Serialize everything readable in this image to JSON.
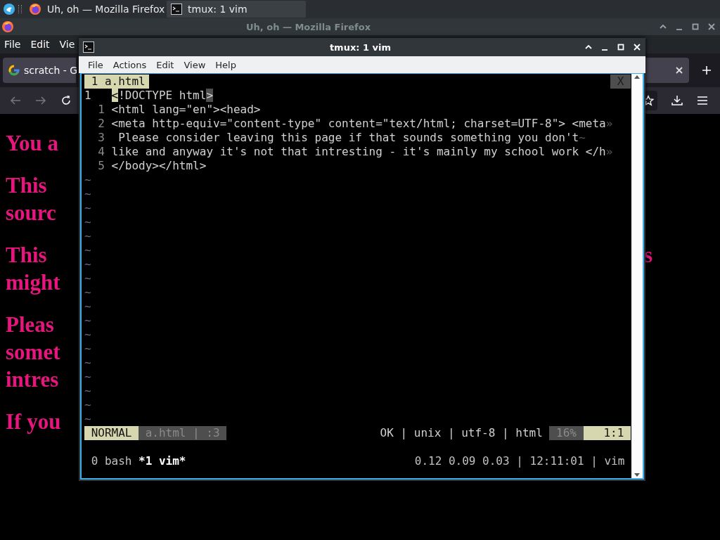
{
  "taskbar": {
    "tasks": [
      {
        "label": "Uh, oh — Mozilla Firefox",
        "kind": "browser",
        "selected": false
      },
      {
        "label": "tmux: 1 vim",
        "kind": "terminal",
        "selected": true
      }
    ]
  },
  "firefox": {
    "title": "Uh, oh — Mozilla Firefox",
    "menu": [
      "File",
      "Edit",
      "Vie"
    ],
    "tab": {
      "title": "scratch - G",
      "selected": true
    },
    "content": [
      {
        "lines": [
          {
            "text": "You a"
          }
        ]
      },
      {
        "lines": [
          {
            "text": "This"
          },
          {
            "text": "sourc"
          }
        ]
      },
      {
        "lines": [
          {
            "text": "This",
            "tail": "s"
          },
          {
            "text": "might"
          }
        ]
      },
      {
        "lines": [
          {
            "text": "Pleas"
          },
          {
            "text": "somet"
          },
          {
            "text": "intres"
          }
        ]
      },
      {
        "lines": [
          {
            "text": "If you"
          }
        ]
      }
    ]
  },
  "terminal": {
    "title": "tmux: 1 vim",
    "menu": [
      "File",
      "Actions",
      "Edit",
      "View",
      "Help"
    ],
    "vim": {
      "buffer_tab": "1 a.html",
      "close_label": "X",
      "lines": [
        {
          "number": "1",
          "current": true,
          "cursor": "<",
          "text": "!DOCTYPE html",
          "match": ">"
        },
        {
          "number": "1",
          "current": false,
          "text": "<html lang=\"en\"><head>"
        },
        {
          "number": "2",
          "current": false,
          "text": "<meta http-equiv=\"content-type\" content=\"text/html; charset=UTF-8\"> <meta",
          "marker": "»"
        },
        {
          "number": "3",
          "current": false,
          "text": " Please consider leaving this page if that sounds something you don't",
          "marker": "~"
        },
        {
          "number": "4",
          "current": false,
          "text": "like and anyway it's not that intresting - it's mainly my school work </h",
          "marker": "»"
        },
        {
          "number": "5",
          "current": false,
          "text": "</body></html>"
        }
      ],
      "filler_rows": [
        "~",
        "~",
        "~",
        "~",
        "~",
        "~",
        "~",
        "~",
        "~",
        "~",
        "~",
        "~",
        "~",
        "~",
        "~",
        "~",
        "~",
        "~"
      ],
      "status": {
        "mode": "NORMAL",
        "file": "a.html | :3",
        "info": "OK | unix | utf-8 | html",
        "percent": "16%",
        "position": "1:1"
      }
    },
    "tmux": {
      "windows": [
        {
          "label": "0 bash",
          "selected": false
        },
        {
          "label": "*1 vim*",
          "selected": true
        }
      ],
      "right": "0.12 0.09 0.03 | 12:11:01 | vim"
    }
  }
}
